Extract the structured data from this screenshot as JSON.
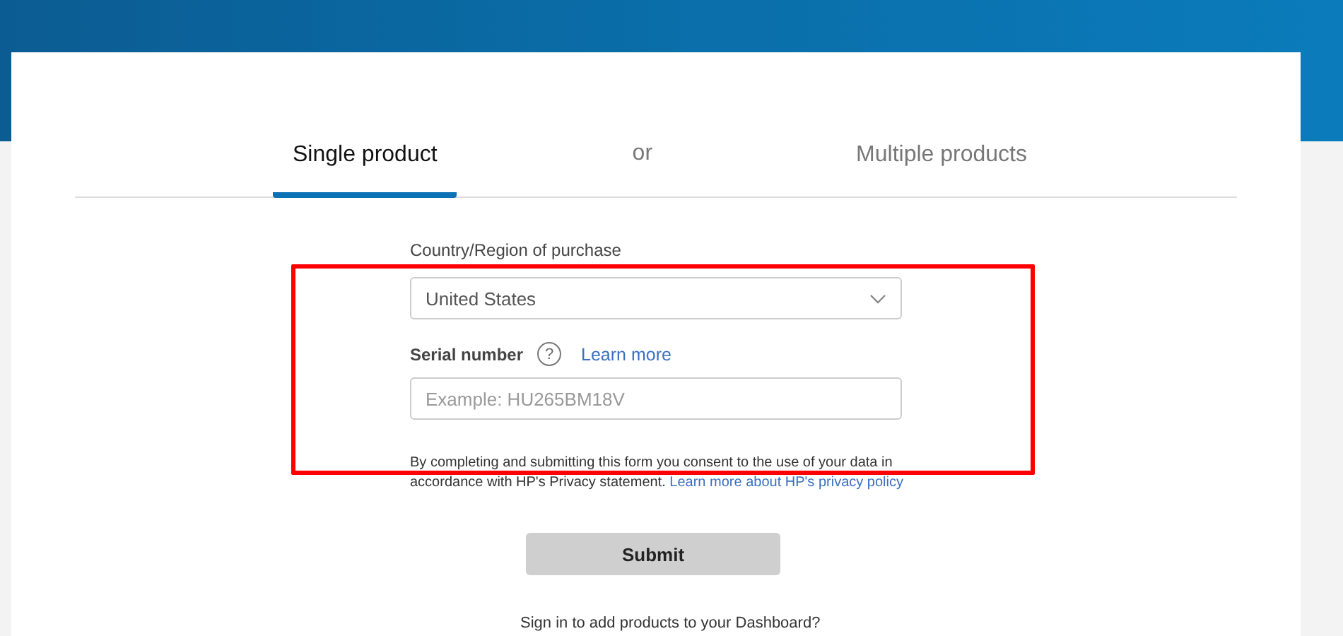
{
  "tabs": [
    {
      "label": "Single product",
      "selected": true
    },
    {
      "label": "or",
      "kind": "separator"
    },
    {
      "label": "Multiple products",
      "selected": false
    }
  ],
  "country": {
    "label": "Country/Region of purchase",
    "value": "United States"
  },
  "serial": {
    "label": "Serial number",
    "help": "?",
    "link": "Learn more",
    "placeholder": "Example: HU265BM18V"
  },
  "consent": {
    "text": "By completing and submitting this form you consent to the use of your data in accordance with HP's Privacy statement.",
    "link": "Learn more about HP's privacy policy"
  },
  "submit": {
    "label": "Submit",
    "disabled": true
  },
  "signin": "Sign in to add products to your Dashboard?"
}
